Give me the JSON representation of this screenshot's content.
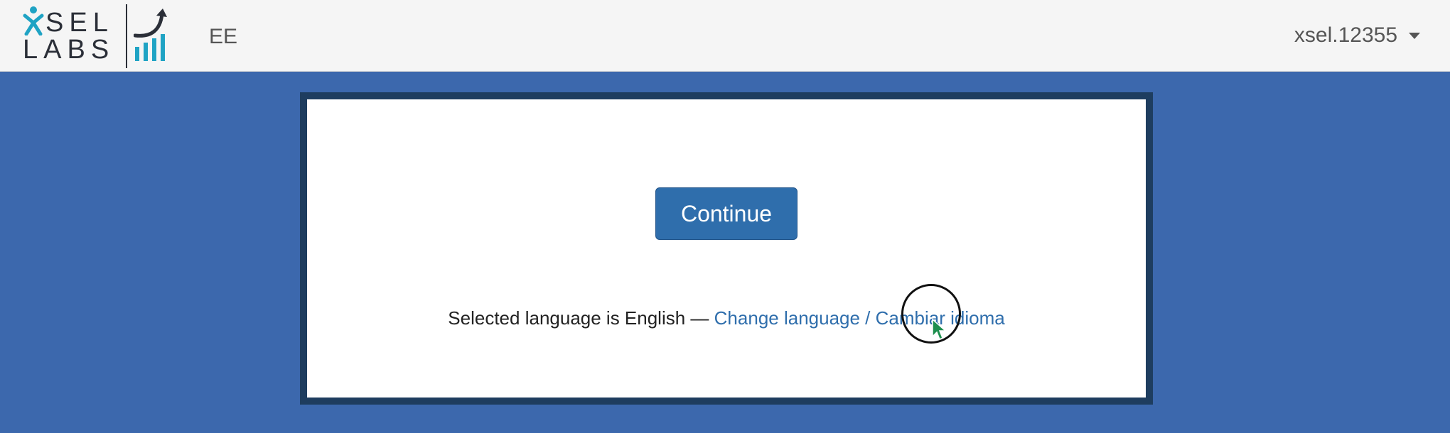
{
  "navbar": {
    "logo": {
      "row1": "XSEL",
      "row2": "LABS",
      "icons": [
        "person-icon",
        "growth-chart-icon"
      ],
      "brand_color": "#1fa3c4"
    },
    "brand_code": "EE",
    "user": {
      "name": "xsel.12355",
      "dropdown_icon": "caret-down-icon"
    }
  },
  "main": {
    "continue_label": "Continue",
    "language": {
      "prefix": "Selected language is English —",
      "link_label": "Change language / Cambiar idioma"
    }
  },
  "cursor": {
    "icon": "pointer-cursor-icon",
    "color": "#1e8f4e"
  },
  "colors": {
    "background": "#3c68ad",
    "panel_border": "#1e3d5f",
    "primary_button": "#2f6eac",
    "link": "#2f6eac"
  }
}
